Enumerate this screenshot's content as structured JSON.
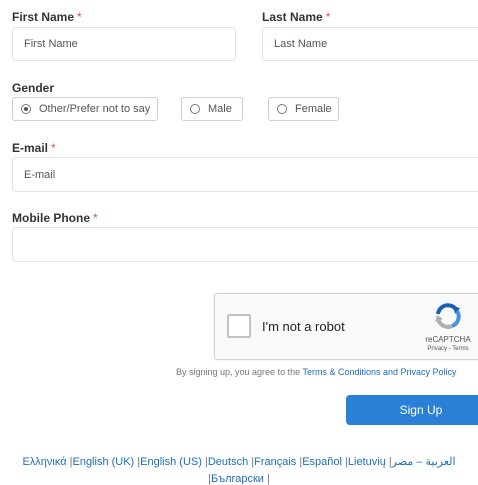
{
  "form": {
    "first_name_label": "First Name",
    "first_name_placeholder": "First Name",
    "last_name_label": "Last Name",
    "last_name_placeholder": "Last Name",
    "required_mark": "*",
    "gender_label": "Gender",
    "gender_options": [
      {
        "label": "Other/Prefer not to say",
        "selected": true
      },
      {
        "label": "Male",
        "selected": false
      },
      {
        "label": "Female",
        "selected": false
      }
    ],
    "email_label": "E-mail",
    "email_placeholder": "E-mail",
    "mobile_label": "Mobile Phone",
    "mobile_placeholder": ""
  },
  "captcha": {
    "text": "I'm not a robot",
    "brand": "reCAPTCHA",
    "privacy": "Privacy",
    "terms": "Terms",
    "links_sep": " - ",
    "colors": {
      "blue": "#4a90e2",
      "dark_blue": "#1a5fb4",
      "grey": "#b0b0b0"
    }
  },
  "agreement": {
    "prefix": "By signing up, you agree to the",
    "link": "Terms & Conditions and Privacy Policy"
  },
  "signup_label": "Sign Up",
  "languages": {
    "line1": [
      "Ελληνικά",
      "English (UK)",
      "English (US)",
      "Deutsch",
      "Français",
      "Español",
      "Lietuvių",
      "العربية – مصر"
    ],
    "line2": [
      "Български"
    ],
    "separator": "|"
  },
  "colors": {
    "accent": "#2a7fd6",
    "link": "#1c6ebc",
    "required": "#d9534f"
  }
}
